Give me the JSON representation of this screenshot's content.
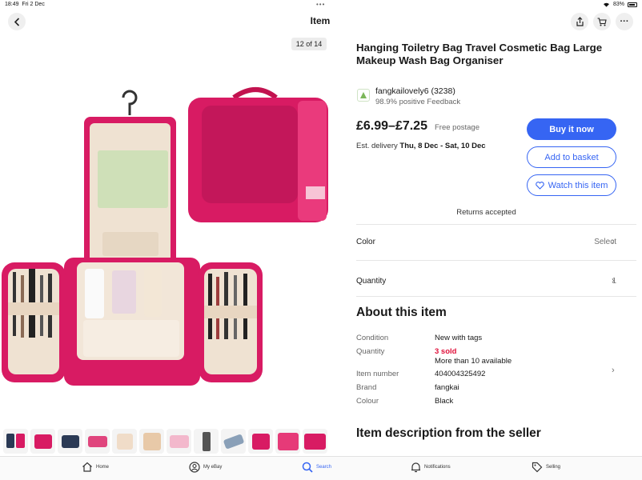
{
  "status_bar": {
    "time": "18:49",
    "date": "Fri 2 Dec",
    "battery": "83%",
    "grabber": "•••"
  },
  "nav": {
    "title": "Item",
    "back_icon": "chevron-left-icon",
    "share_icon": "share-icon",
    "cart_icon": "cart-icon",
    "more_label": "···"
  },
  "gallery": {
    "counter": "12 of 14",
    "thumbnail_count": 13
  },
  "product": {
    "title": "Hanging Toiletry Bag Travel Cosmetic Bag Large Makeup Wash Bag Organiser",
    "seller_name": "fangkailovely6 (3238)",
    "seller_feedback": "98.9% positive Feedback",
    "price": "£6.99–£7.25",
    "postage": "Free postage",
    "delivery_label": "Est. delivery",
    "delivery_dates": "Thu, 8 Dec - Sat, 10 Dec",
    "returns": "Returns accepted"
  },
  "buttons": {
    "buy": "Buy it now",
    "basket": "Add to basket",
    "watch": "Watch this item"
  },
  "variations": {
    "color_label": "Color",
    "color_value": "Select",
    "quantity_label": "Quantity",
    "quantity_value": "1"
  },
  "about": {
    "heading": "About this item",
    "specs": [
      {
        "label": "Condition",
        "value": "New with tags"
      },
      {
        "label": "Quantity",
        "value": "3 sold",
        "extra": "More than 10 available"
      },
      {
        "label": "Item number",
        "value": "404004325492"
      },
      {
        "label": "Brand",
        "value": "fangkai"
      },
      {
        "label": "Colour",
        "value": "Black"
      }
    ]
  },
  "description_heading": "Item description from the seller",
  "tabs": [
    {
      "label": "Home",
      "icon": "home-icon"
    },
    {
      "label": "My eBay",
      "icon": "user-icon"
    },
    {
      "label": "Search",
      "icon": "search-icon",
      "active": true
    },
    {
      "label": "Notifications",
      "icon": "bell-icon"
    },
    {
      "label": "Selling",
      "icon": "tag-icon"
    }
  ],
  "colors": {
    "accent": "#3665f3",
    "sold_red": "#e0103a",
    "bag_pink": "#d81b63"
  }
}
